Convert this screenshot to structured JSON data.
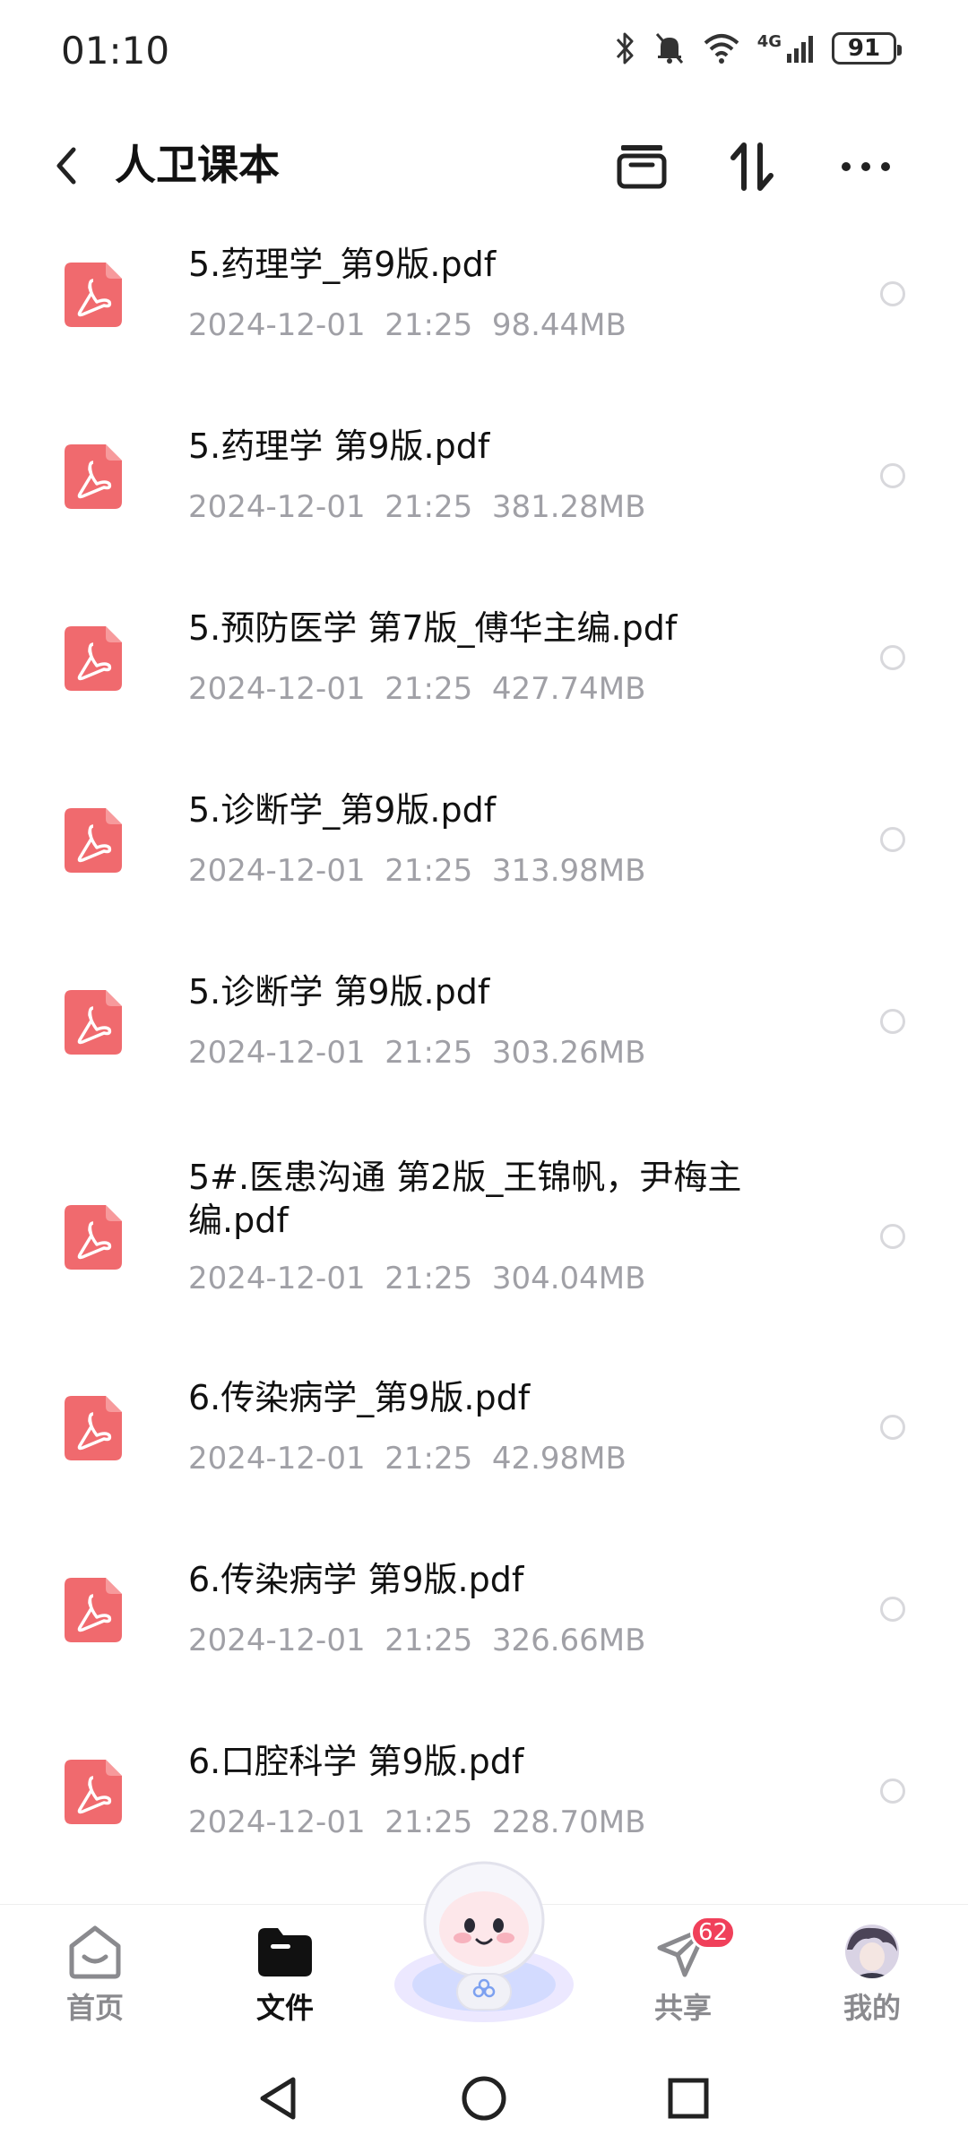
{
  "status": {
    "time": "01:10",
    "network": "4G",
    "battery": "91"
  },
  "header": {
    "title": "人卫课本"
  },
  "files": [
    {
      "name": "5.药理学_第9版.pdf",
      "date": "2024-12-01",
      "time": "21:25",
      "size": "98.44MB"
    },
    {
      "name": "5.药理学 第9版.pdf",
      "date": "2024-12-01",
      "time": "21:25",
      "size": "381.28MB"
    },
    {
      "name": "5.预防医学 第7版_傅华主编.pdf",
      "date": "2024-12-01",
      "time": "21:25",
      "size": "427.74MB"
    },
    {
      "name": "5.诊断学_第9版.pdf",
      "date": "2024-12-01",
      "time": "21:25",
      "size": "313.98MB"
    },
    {
      "name": "5.诊断学 第9版.pdf",
      "date": "2024-12-01",
      "time": "21:25",
      "size": "303.26MB"
    },
    {
      "name": "5#.医患沟通 第2版_王锦帆，尹梅主编.pdf",
      "date": "2024-12-01",
      "time": "21:25",
      "size": "304.04MB"
    },
    {
      "name": "6.传染病学_第9版.pdf",
      "date": "2024-12-01",
      "time": "21:25",
      "size": "42.98MB"
    },
    {
      "name": "6.传染病学 第9版.pdf",
      "date": "2024-12-01",
      "time": "21:25",
      "size": "326.66MB"
    },
    {
      "name": "6.口腔科学 第9版.pdf",
      "date": "2024-12-01",
      "time": "21:25",
      "size": "228.70MB"
    }
  ],
  "tabs": {
    "home": "首页",
    "files": "文件",
    "share": "共享",
    "share_badge": "62",
    "me": "我的"
  },
  "icons": {
    "pdf": "pdf-file-icon",
    "back": "chevron-left-icon",
    "header_actions": [
      "archive-icon",
      "sort-icon",
      "more-icon"
    ],
    "nav": [
      "nav-back-icon",
      "nav-home-icon",
      "nav-recents-icon"
    ]
  },
  "colors": {
    "pdf_red": "#f06a6e",
    "badge_red": "#f0405a",
    "meta_gray": "#a0a0a6"
  }
}
